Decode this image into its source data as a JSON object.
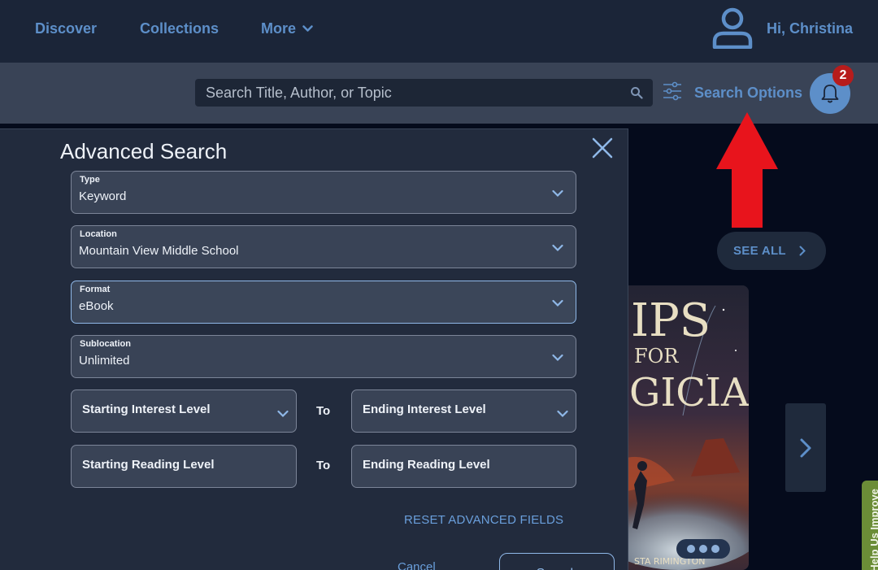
{
  "nav": {
    "discover": "Discover",
    "collections": "Collections",
    "more": "More",
    "greeting": "Hi, Christina"
  },
  "search": {
    "placeholder": "Search Title, Author, or Topic",
    "options_label": "Search Options",
    "notification_count": "2"
  },
  "content": {
    "see_all": "SEE ALL",
    "book_title_fragment_1": "IPS",
    "book_title_fragment_2": "FOR",
    "book_title_fragment_3": "GICIANS",
    "book_author_fragment": "STA RIMINGTON",
    "feedback_tab": "Help Us Improve"
  },
  "modal": {
    "title": "Advanced Search",
    "type": {
      "label": "Type",
      "value": "Keyword"
    },
    "location": {
      "label": "Location",
      "value": "Mountain View Middle School"
    },
    "format": {
      "label": "Format",
      "value": "eBook"
    },
    "sublocation": {
      "label": "Sublocation",
      "value": "Unlimited"
    },
    "start_interest": "Starting Interest Level",
    "end_interest": "Ending Interest Level",
    "start_reading": "Starting Reading Level",
    "end_reading": "Ending Reading Level",
    "to_label": "To",
    "reset": "RESET ADVANCED FIELDS",
    "cancel": "Cancel",
    "search": "Search"
  },
  "colors": {
    "accent": "#5d8fc9",
    "badge": "#b71c1c",
    "annotation_arrow": "#e8141c"
  }
}
